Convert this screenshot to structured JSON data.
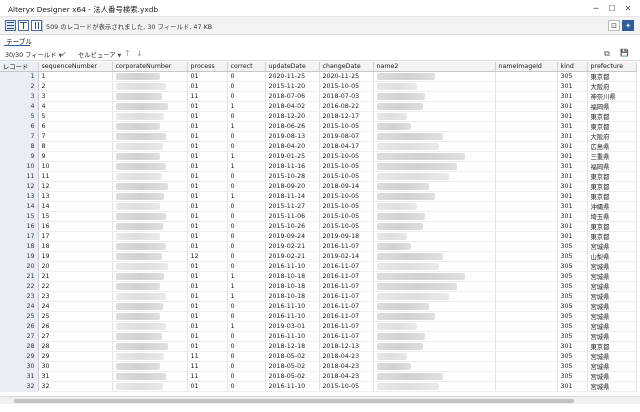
{
  "window": {
    "title": "Alteryx Designer x64 - 法人番号検索.yxdb",
    "minimize_glyph": "─",
    "maximize_glyph": "☐",
    "close_glyph": "✕"
  },
  "results": {
    "status_message": "509 のレコードが表示されました, 30 フィールド, 47 KB",
    "layout_icons": [
      "grid-layout-icon",
      "split-layout-icon",
      "column-layout-icon"
    ]
  },
  "tabs": [
    {
      "label": "テーブル",
      "active": true
    }
  ],
  "toolbar": {
    "fields_label": "30/30 フィールド",
    "cell_viewer_label": "セルビューア",
    "dropdown_glyph": "▼",
    "apply_glyph": "✔",
    "up_glyph": "↑",
    "down_glyph": "↓",
    "copy_glyph": "⧉",
    "save_glyph": "💾"
  },
  "table": {
    "columns": [
      "レコード",
      "sequenceNumber",
      "corporateNumber",
      "process",
      "correct",
      "updateDate",
      "changeDate",
      "name2",
      "nameImageId",
      "kind",
      "prefecture"
    ],
    "rows": [
      [
        "1",
        "1",
        "",
        "01",
        "0",
        "2020-11-25",
        "2020-11-25",
        "",
        "",
        "305",
        "東京都"
      ],
      [
        "2",
        "2",
        "",
        "01",
        "0",
        "2015-11-20",
        "2015-10-05",
        "",
        "",
        "301",
        "大阪府"
      ],
      [
        "3",
        "3",
        "",
        "11",
        "0",
        "2018-07-06",
        "2018-07-03",
        "",
        "",
        "301",
        "神奈川県"
      ],
      [
        "4",
        "4",
        "",
        "01",
        "1",
        "2018-04-02",
        "2016-08-22",
        "",
        "",
        "301",
        "福岡県"
      ],
      [
        "5",
        "5",
        "",
        "01",
        "0",
        "2018-12-20",
        "2018-12-17",
        "",
        "",
        "301",
        "東京都"
      ],
      [
        "6",
        "6",
        "",
        "01",
        "1",
        "2018-06-26",
        "2015-10-05",
        "",
        "",
        "301",
        "東京都"
      ],
      [
        "7",
        "7",
        "",
        "01",
        "0",
        "2019-08-13",
        "2019-08-07",
        "",
        "",
        "301",
        "大阪府"
      ],
      [
        "8",
        "8",
        "",
        "01",
        "0",
        "2018-04-20",
        "2018-04-17",
        "",
        "",
        "301",
        "広島県"
      ],
      [
        "9",
        "9",
        "",
        "01",
        "1",
        "2019-01-25",
        "2015-10-05",
        "",
        "",
        "301",
        "三重県"
      ],
      [
        "10",
        "10",
        "",
        "01",
        "1",
        "2018-11-16",
        "2015-10-05",
        "",
        "",
        "301",
        "福岡県"
      ],
      [
        "11",
        "11",
        "",
        "01",
        "0",
        "2015-10-28",
        "2015-10-05",
        "",
        "",
        "301",
        "東京都"
      ],
      [
        "12",
        "12",
        "",
        "01",
        "0",
        "2018-09-20",
        "2018-09-14",
        "",
        "",
        "301",
        "東京都"
      ],
      [
        "13",
        "13",
        "",
        "01",
        "1",
        "2018-11-14",
        "2015-10-05",
        "",
        "",
        "301",
        "東京都"
      ],
      [
        "14",
        "14",
        "",
        "01",
        "0",
        "2015-11-27",
        "2015-10-05",
        "",
        "",
        "301",
        "沖縄県"
      ],
      [
        "15",
        "15",
        "",
        "01",
        "0",
        "2015-11-06",
        "2015-10-05",
        "",
        "",
        "301",
        "埼玉県"
      ],
      [
        "16",
        "16",
        "",
        "01",
        "0",
        "2015-10-26",
        "2015-10-05",
        "",
        "",
        "301",
        "東京都"
      ],
      [
        "17",
        "17",
        "",
        "01",
        "0",
        "2019-09-24",
        "2019-09-18",
        "",
        "",
        "301",
        "東京都"
      ],
      [
        "18",
        "18",
        "",
        "01",
        "0",
        "2019-02-21",
        "2016-11-07",
        "",
        "",
        "305",
        "宮城県"
      ],
      [
        "19",
        "19",
        "",
        "12",
        "0",
        "2019-02-21",
        "2019-02-14",
        "",
        "",
        "305",
        "山梨県"
      ],
      [
        "20",
        "20",
        "",
        "01",
        "0",
        "2016-11-10",
        "2016-11-07",
        "",
        "",
        "305",
        "宮城県"
      ],
      [
        "21",
        "21",
        "",
        "01",
        "1",
        "2018-10-18",
        "2016-11-07",
        "",
        "",
        "305",
        "宮城県"
      ],
      [
        "22",
        "22",
        "",
        "01",
        "1",
        "2018-10-18",
        "2016-11-07",
        "",
        "",
        "305",
        "宮城県"
      ],
      [
        "23",
        "23",
        "",
        "01",
        "1",
        "2018-10-18",
        "2016-11-07",
        "",
        "",
        "305",
        "宮城県"
      ],
      [
        "24",
        "24",
        "",
        "01",
        "0",
        "2016-11-10",
        "2016-11-07",
        "",
        "",
        "305",
        "宮城県"
      ],
      [
        "25",
        "25",
        "",
        "01",
        "0",
        "2016-11-10",
        "2016-11-07",
        "",
        "",
        "305",
        "宮城県"
      ],
      [
        "26",
        "26",
        "",
        "01",
        "1",
        "2019-03-01",
        "2016-11-07",
        "",
        "",
        "305",
        "宮城県"
      ],
      [
        "27",
        "27",
        "",
        "01",
        "0",
        "2016-11-10",
        "2016-11-07",
        "",
        "",
        "305",
        "宮城県"
      ],
      [
        "28",
        "28",
        "",
        "01",
        "0",
        "2018-12-18",
        "2018-12-13",
        "",
        "",
        "301",
        "東京都"
      ],
      [
        "29",
        "29",
        "",
        "11",
        "0",
        "2018-05-02",
        "2018-04-23",
        "",
        "",
        "305",
        "宮城県"
      ],
      [
        "30",
        "30",
        "",
        "11",
        "0",
        "2018-05-02",
        "2018-04-23",
        "",
        "",
        "305",
        "宮城県"
      ],
      [
        "31",
        "31",
        "",
        "11",
        "0",
        "2018-05-02",
        "2018-04-23",
        "",
        "",
        "305",
        "宮城県"
      ],
      [
        "32",
        "32",
        "",
        "01",
        "0",
        "2016-11-10",
        "2015-10-05",
        "",
        "",
        "301",
        "宮城県"
      ]
    ]
  }
}
